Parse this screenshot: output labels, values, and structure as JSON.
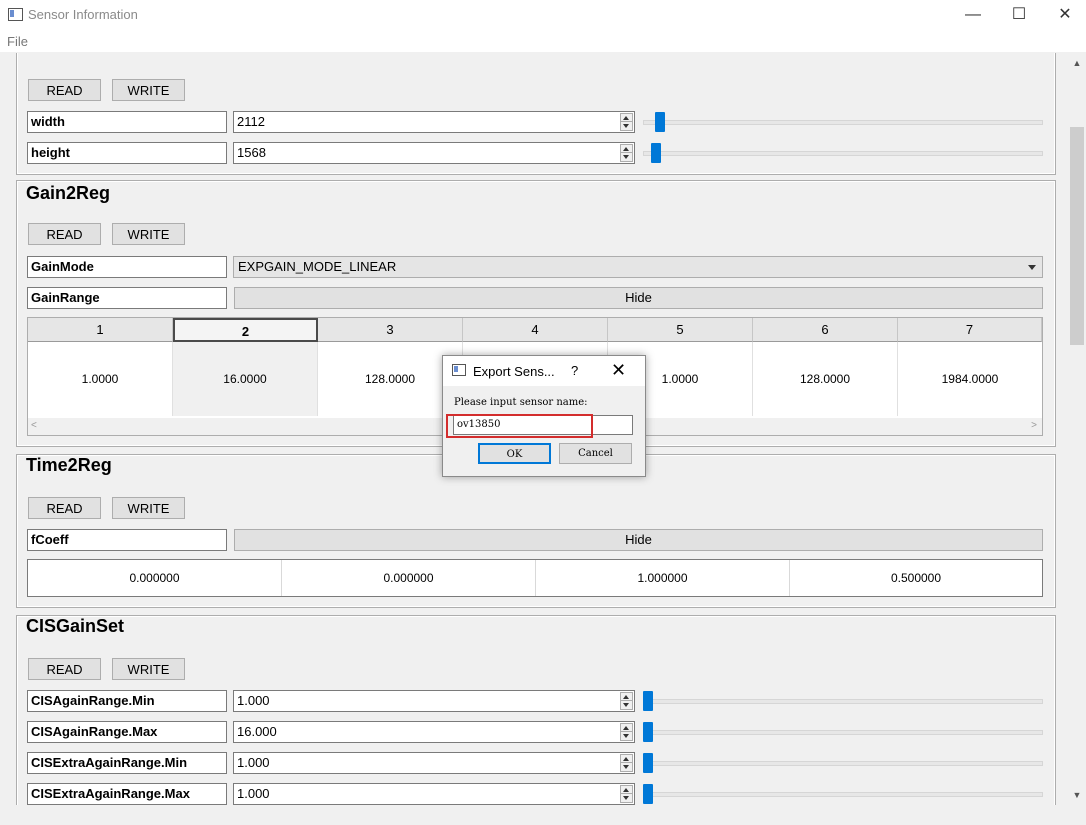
{
  "window": {
    "title": "Sensor Information",
    "minimize": "—",
    "maximize": "☐",
    "close": "✕"
  },
  "menu": {
    "file": "File"
  },
  "common": {
    "read": "READ",
    "write": "WRITE",
    "hide": "Hide"
  },
  "size_section": {
    "rows": [
      {
        "label": "width",
        "value": "2112",
        "slider": 0.02
      },
      {
        "label": "height",
        "value": "1568",
        "slider": 0.015
      }
    ]
  },
  "gain2reg": {
    "title": "Gain2Reg",
    "gain_mode_label": "GainMode",
    "gain_mode_value": "EXPGAIN_MODE_LINEAR",
    "gain_range_label": "GainRange",
    "table": {
      "headers": [
        "1",
        "2",
        "3",
        "4",
        "5",
        "6",
        "7"
      ],
      "values": [
        "1.0000",
        "16.0000",
        "128.0000",
        "",
        "1.0000",
        "128.0000",
        "1984.0000"
      ],
      "selected_column": "2"
    }
  },
  "time2reg": {
    "title": "Time2Reg",
    "coeff_label": "fCoeff",
    "coeffs": [
      "0.000000",
      "0.000000",
      "1.000000",
      "0.500000"
    ]
  },
  "cisgainset": {
    "title": "CISGainSet",
    "rows": [
      {
        "label": "CISAgainRange.Min",
        "value": "1.000",
        "slider": 0.0
      },
      {
        "label": "CISAgainRange.Max",
        "value": "16.000",
        "slider": 0.0
      },
      {
        "label": "CISExtraAgainRange.Min",
        "value": "1.000",
        "slider": 0.0
      },
      {
        "label": "CISExtraAgainRange.Max",
        "value": "1.000",
        "slider": 0.0
      }
    ]
  },
  "dialog": {
    "title": "Export Sens...",
    "help": "?",
    "close": "✕",
    "prompt": "Please input sensor name:",
    "input_value": "ov13850",
    "ok": "OK",
    "cancel": "Cancel"
  },
  "colors": {
    "accent": "#0078d7",
    "highlight": "#d32d2d"
  }
}
